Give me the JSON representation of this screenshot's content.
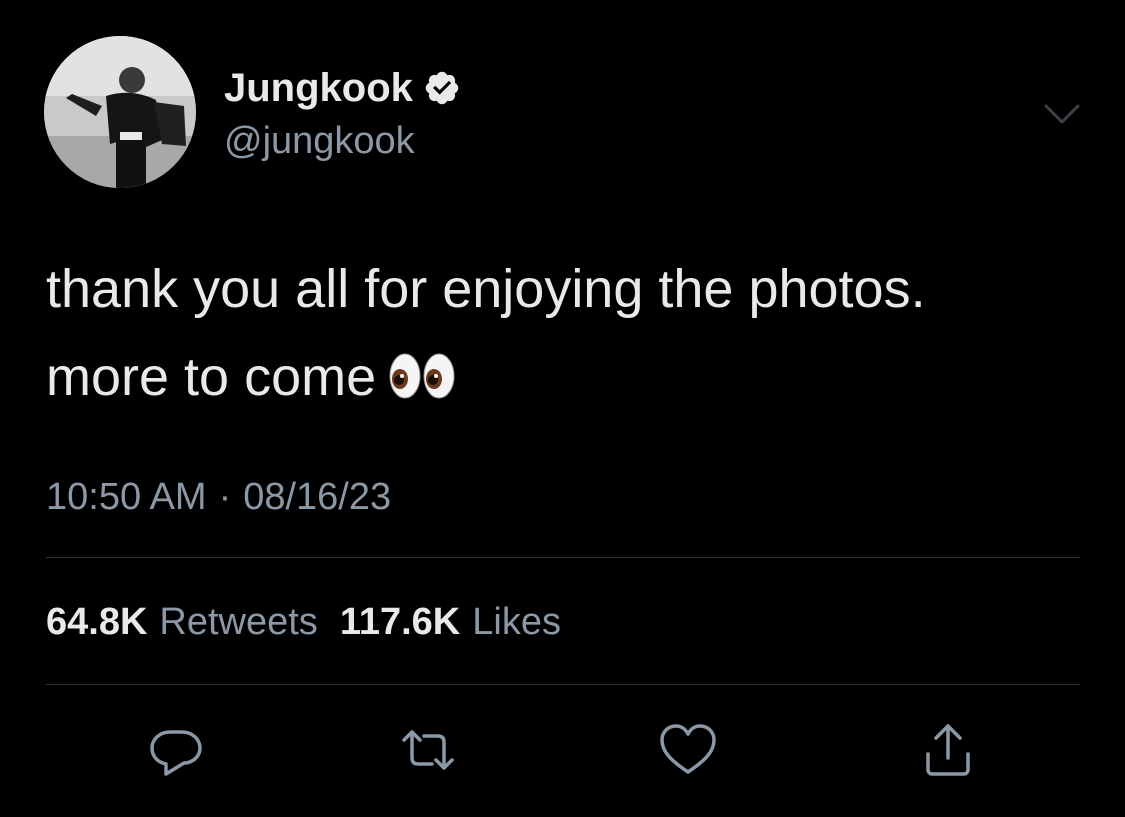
{
  "author": {
    "display_name": "Jungkook",
    "handle": "@jungkook",
    "verified": true,
    "verified_icon": "verified-badge-icon",
    "avatar_icon": "profile-photo"
  },
  "tweet": {
    "text_line1": "thank you all for enjoying the photos.",
    "text_line2": "more to come",
    "emoji": "👀"
  },
  "meta": {
    "time": "10:50 AM",
    "separator": "·",
    "date": "08/16/23"
  },
  "stats": {
    "retweets_count": "64.8K",
    "retweets_label": "Retweets",
    "likes_count": "117.6K",
    "likes_label": "Likes"
  },
  "actions": [
    {
      "name": "reply",
      "icon": "reply-icon"
    },
    {
      "name": "retweet",
      "icon": "retweet-icon"
    },
    {
      "name": "like",
      "icon": "heart-icon"
    },
    {
      "name": "share",
      "icon": "share-icon"
    }
  ],
  "colors": {
    "background": "#000000",
    "primary_text": "#e7e9ea",
    "secondary_text": "#8b98a5",
    "divider": "#2f3336"
  }
}
